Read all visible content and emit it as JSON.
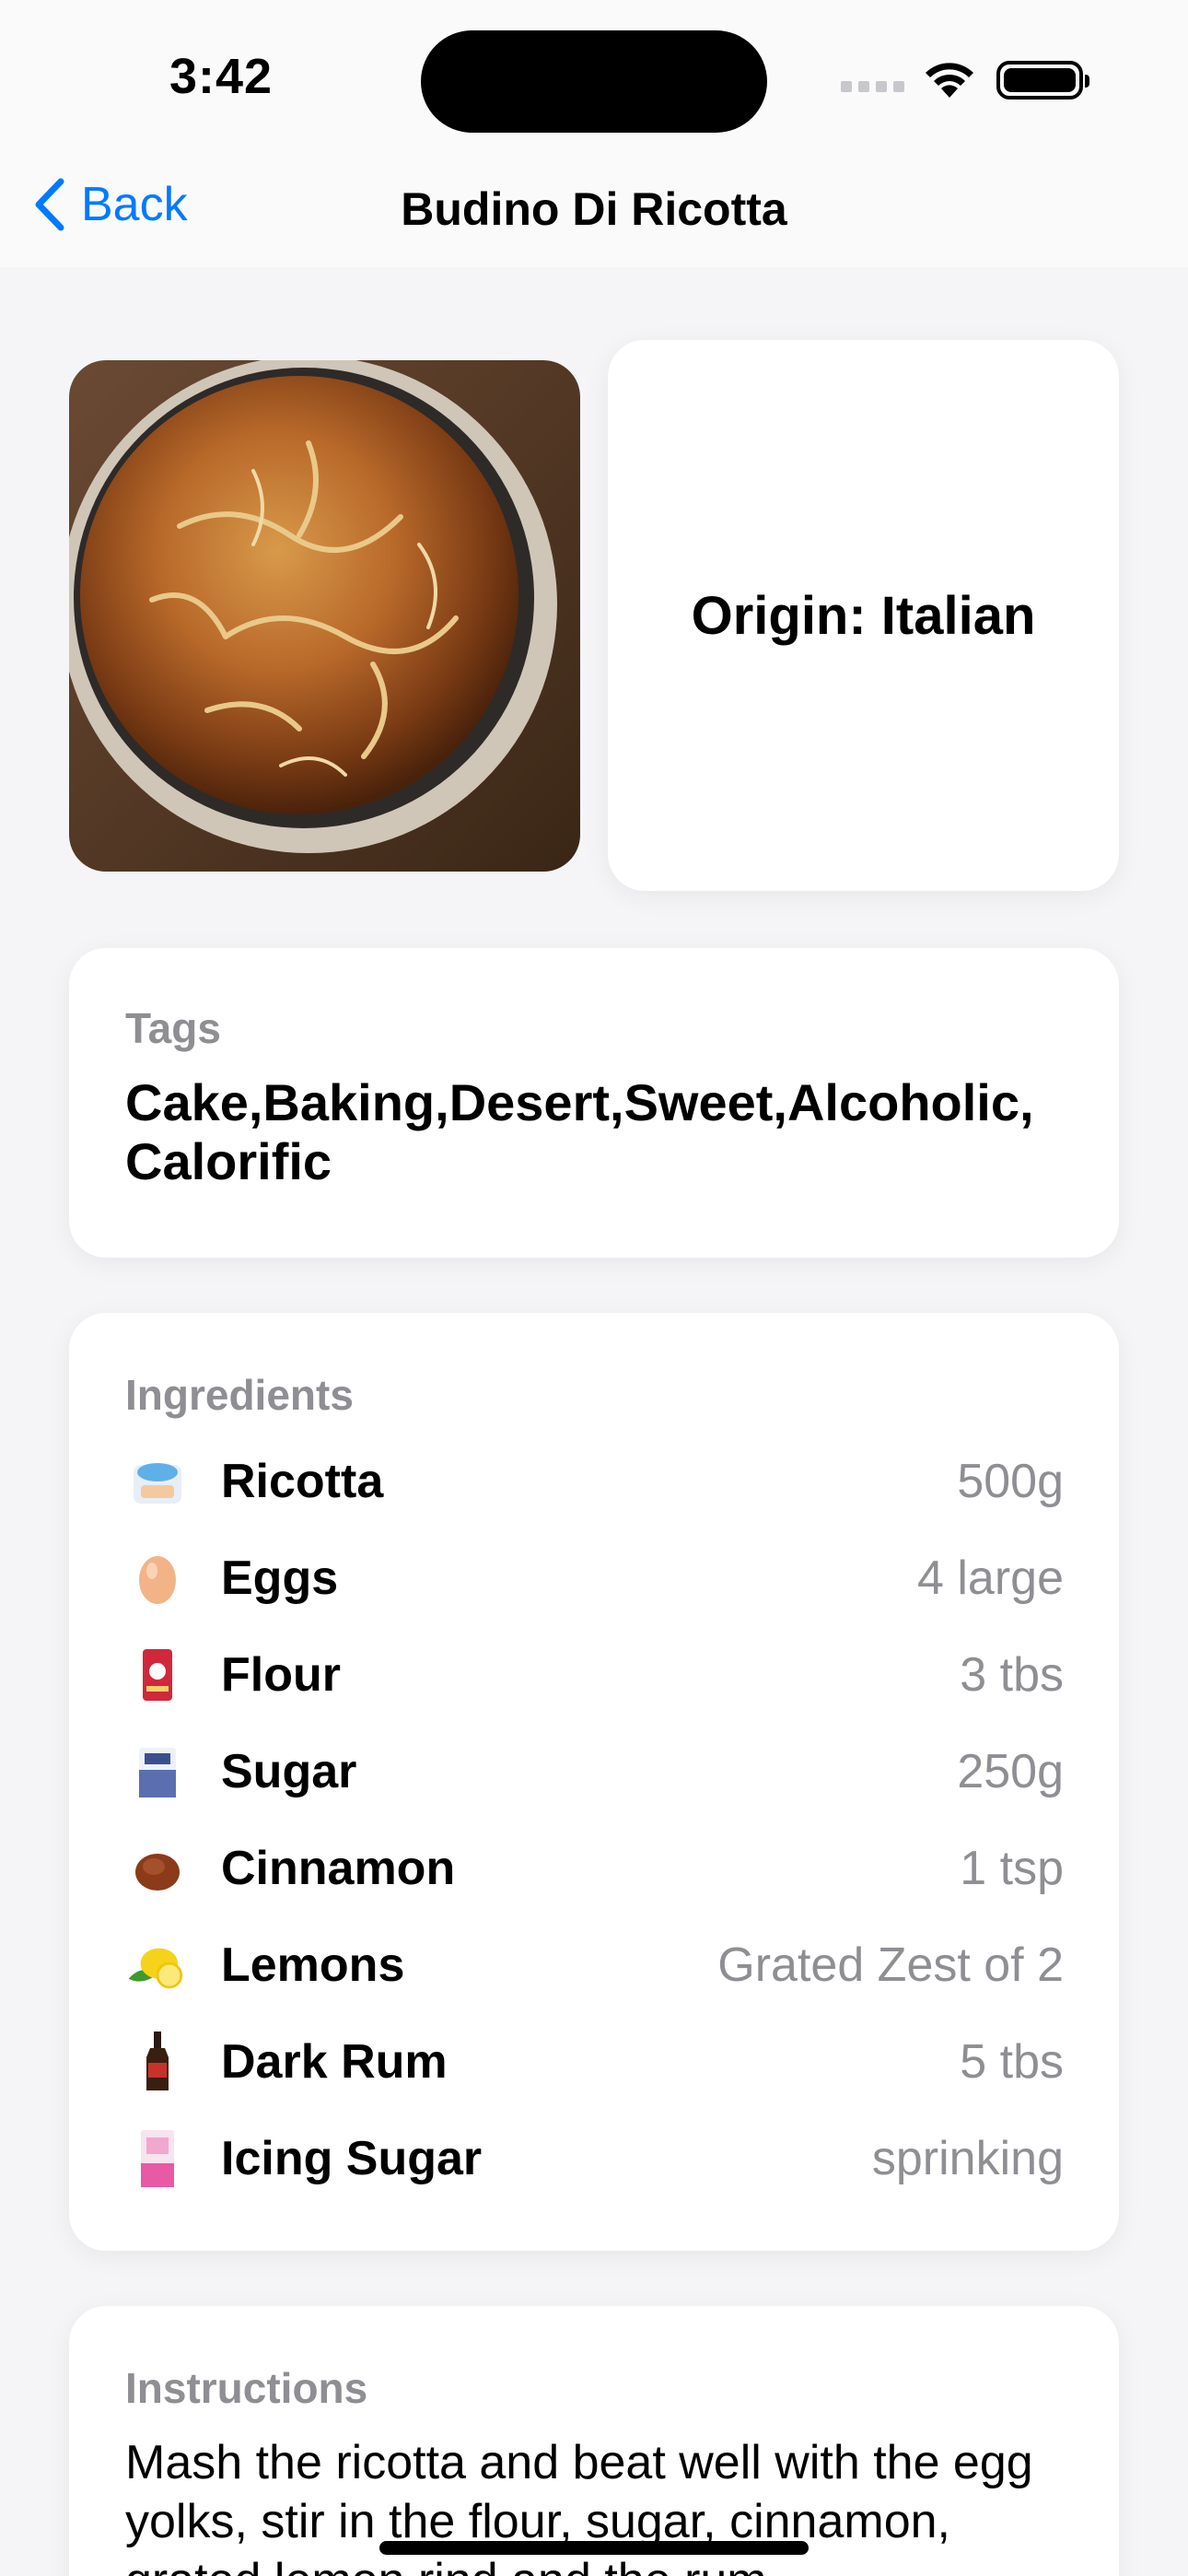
{
  "status": {
    "time": "3:42"
  },
  "nav": {
    "back_label": "Back",
    "title": "Budino Di Ricotta"
  },
  "origin": {
    "text": "Origin: Italian"
  },
  "tags": {
    "label": "Tags",
    "value": "Cake,Baking,Desert,Sweet,Alcoholic,Calorific"
  },
  "ingredients": {
    "label": "Ingredients",
    "items": [
      {
        "name": "Ricotta",
        "amount": "500g",
        "icon": "ricotta-icon"
      },
      {
        "name": "Eggs",
        "amount": "4 large",
        "icon": "egg-icon"
      },
      {
        "name": "Flour",
        "amount": "3 tbs",
        "icon": "flour-icon"
      },
      {
        "name": "Sugar",
        "amount": "250g",
        "icon": "sugar-icon"
      },
      {
        "name": "Cinnamon",
        "amount": "1 tsp",
        "icon": "cinnamon-icon"
      },
      {
        "name": "Lemons",
        "amount": "Grated Zest of 2",
        "icon": "lemon-icon"
      },
      {
        "name": "Dark Rum",
        "amount": "5 tbs",
        "icon": "rum-icon"
      },
      {
        "name": "Icing Sugar",
        "amount": "sprinking",
        "icon": "icing-sugar-icon"
      }
    ]
  },
  "instructions": {
    "label": "Instructions",
    "text": "Mash the ricotta and beat well with the egg yolks, stir in the flour, sugar, cinnamon, grated lemon rind and the rum"
  },
  "colors": {
    "accent": "#007aff",
    "secondary_text": "#8e8e93",
    "background": "#f5f5f7"
  }
}
